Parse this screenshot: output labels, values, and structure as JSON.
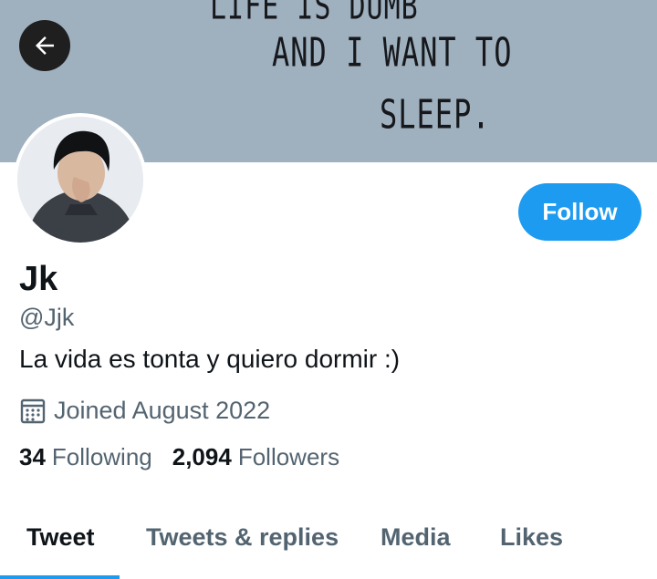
{
  "banner": {
    "lines": [
      "LIFE IS DUMB",
      "AND I WANT TO",
      "SLEEP."
    ],
    "background": "#9fb0bf"
  },
  "back_button": {
    "icon": "arrow-left-icon"
  },
  "profile": {
    "display_name": "Jk",
    "handle": "@Jjk",
    "bio": "La vida es tonta y quiero dormir :)",
    "joined": "Joined August 2022",
    "joined_icon": "calendar-icon"
  },
  "follow_button": {
    "label": "Follow",
    "color": "#1d9bf0"
  },
  "stats": {
    "following_count": "34",
    "following_label": "Following",
    "followers_count": "2,094",
    "followers_label": "Followers"
  },
  "tabs": [
    {
      "label": "Tweet",
      "active": true
    },
    {
      "label": "Tweets & replies",
      "active": false
    },
    {
      "label": "Media",
      "active": false
    },
    {
      "label": "Likes",
      "active": false
    }
  ],
  "colors": {
    "accent": "#1d9bf0",
    "text_primary": "#0f1419",
    "text_secondary": "#536471"
  }
}
